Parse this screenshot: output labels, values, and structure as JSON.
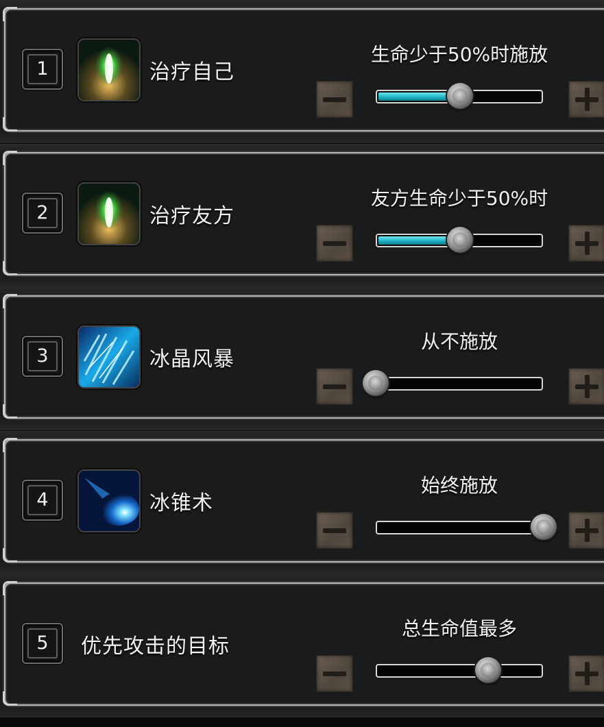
{
  "rows": [
    {
      "number": "1",
      "name": "治疗自己",
      "setting": "生命少于50%时施放",
      "level": 0.5,
      "icon": "green-heal-icon",
      "has_icon": true
    },
    {
      "number": "2",
      "name": "治疗友方",
      "setting": "友方生命少于50%时",
      "level": 0.5,
      "icon": "green-heal-icon",
      "has_icon": true
    },
    {
      "number": "3",
      "name": "冰晶风暴",
      "setting": "从不施放",
      "level": 0.0,
      "icon": "ice-storm-icon",
      "has_icon": true
    },
    {
      "number": "4",
      "name": "冰锥术",
      "setting": "始终施放",
      "level": 1.0,
      "icon": "ice-cone-icon",
      "has_icon": true
    },
    {
      "number": "5",
      "name": "优先攻击的目标",
      "setting": "总生命值最多",
      "level": 0.67,
      "icon": "",
      "has_icon": false
    }
  ],
  "colors": {
    "slider_fill": "#1fb3c4",
    "frame": "#b9b9b9",
    "button": "#5a5046"
  }
}
